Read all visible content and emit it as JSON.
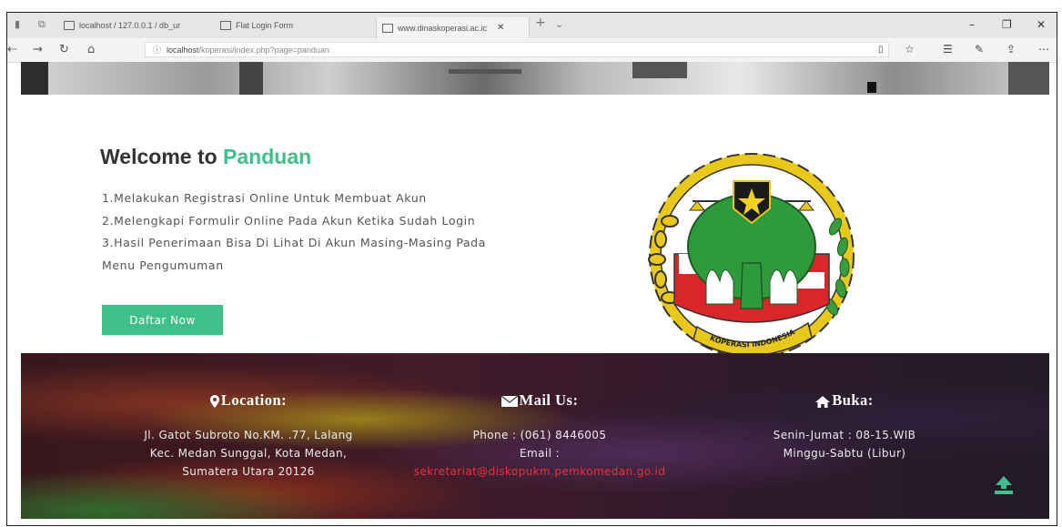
{
  "browser": {
    "tabs": [
      {
        "label": "localhost / 127.0.0.1 / db_ur"
      },
      {
        "label": "Flat Login Form"
      },
      {
        "label": "www.dinaskoperasi.ac.ic"
      }
    ],
    "url_host": "localhost",
    "url_path": "/koperasi/index.php?page=panduan"
  },
  "hero": {
    "title_prefix": "Welcome to",
    "title_highlight": "Panduan",
    "steps": [
      "1.Melakukan Registrasi Online Untuk Membuat Akun",
      "2.Melengkapi Formulir Online Pada Akun Ketika Sudah Login",
      "3.Hasil Penerimaan Bisa Di Lihat Di Akun Masing-Masing Pada Menu Pengumuman"
    ],
    "button_label": "Daftar Now",
    "emblem_text": "KOPERASI INDONESIA"
  },
  "footer": {
    "location": {
      "title": "Location:",
      "lines": [
        "Jl. Gatot Subroto No.KM. .77, Lalang",
        "Kec. Medan Sunggal, Kota Medan,",
        "Sumatera Utara 20126"
      ]
    },
    "mail": {
      "title": "Mail Us:",
      "phone": "Phone : (061) 8446005",
      "email_label": "Email :",
      "email": "sekretariat@diskopukm.pemkomedan.go.id"
    },
    "open": {
      "title": "Buka:",
      "lines": [
        "Senin-Jumat : 08-15.WIB",
        "Minggu-Sabtu (Libur)"
      ]
    }
  },
  "colors": {
    "accent": "#3fbf8a",
    "email": "#e8323c"
  }
}
